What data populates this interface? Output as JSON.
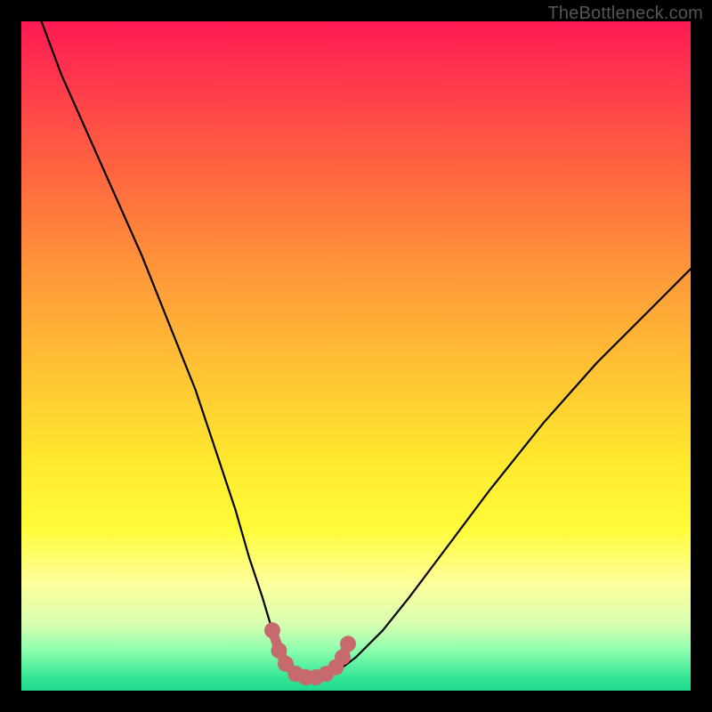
{
  "watermark": "TheBottleneck.com",
  "chart_data": {
    "type": "line",
    "title": "",
    "xlabel": "",
    "ylabel": "",
    "xlim": [
      0,
      100
    ],
    "ylim": [
      0,
      100
    ],
    "series": [
      {
        "name": "bottleneck-curve",
        "x": [
          3,
          6,
          10,
          14,
          18,
          22,
          26,
          29,
          32,
          34,
          36,
          37.5,
          39,
          40.5,
          42,
          44,
          46,
          48,
          50,
          54,
          58,
          64,
          70,
          78,
          86,
          94,
          100
        ],
        "y": [
          100,
          92,
          83,
          74,
          65,
          55,
          45,
          36,
          27,
          20,
          14,
          9,
          5,
          3,
          2,
          2,
          2.5,
          3.5,
          5,
          9,
          14,
          22,
          30,
          40,
          49,
          57,
          63
        ]
      }
    ],
    "marker_region": {
      "name": "optimal-zone",
      "points": [
        {
          "x": 37.5,
          "y": 9
        },
        {
          "x": 38.5,
          "y": 6
        },
        {
          "x": 39.5,
          "y": 4
        },
        {
          "x": 41,
          "y": 2.5
        },
        {
          "x": 42.5,
          "y": 2
        },
        {
          "x": 44,
          "y": 2
        },
        {
          "x": 45.5,
          "y": 2.5
        },
        {
          "x": 47,
          "y": 3.5
        },
        {
          "x": 48,
          "y": 5
        },
        {
          "x": 48.8,
          "y": 7
        }
      ]
    },
    "colors": {
      "curve": "#000000",
      "marker_stroke": "#c76a6e",
      "marker_fill": "#c76a6e"
    }
  }
}
